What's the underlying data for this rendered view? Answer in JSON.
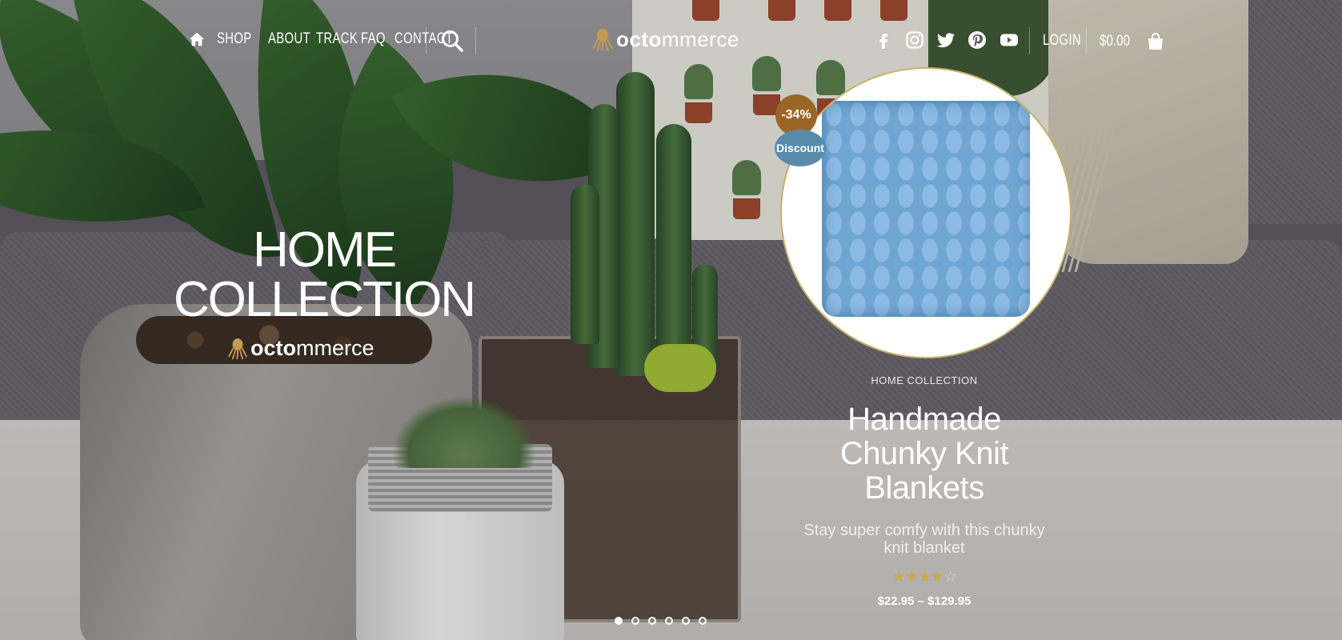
{
  "header": {
    "nav": [
      {
        "label": "SHOP",
        "has_dropdown": true
      },
      {
        "label": "ABOUT"
      },
      {
        "label": "TRACK"
      },
      {
        "label": "FAQ"
      },
      {
        "label": "CONTACT"
      }
    ],
    "logo": {
      "bold": "octo",
      "regular": "mmerce"
    },
    "socials": [
      "facebook-icon",
      "instagram-icon",
      "twitter-icon",
      "pinterest-icon",
      "youtube-icon"
    ],
    "login_label": "LOGIN",
    "cart_total": "$0.00"
  },
  "hero": {
    "headline_line1": "HOME",
    "headline_line2": "COLLECTION",
    "brand": {
      "bold": "octo",
      "regular": "mmerce"
    }
  },
  "product": {
    "discount_percent": "-34%",
    "discount_label": "Discount",
    "category": "HOME COLLECTION",
    "title_lines": [
      "Handmade",
      "Chunky Knit",
      "Blankets"
    ],
    "description_lines": [
      "Stay super comfy with this chunky",
      "knit blanket"
    ],
    "rating": 4,
    "rating_max": 5,
    "price": "$22.95 – $129.95"
  },
  "slider": {
    "slide_count": 6,
    "active_index": 0
  },
  "colors": {
    "discount_badge": "#9a6628",
    "discount_pill": "#5a8bad",
    "star": "#c9a94d"
  }
}
